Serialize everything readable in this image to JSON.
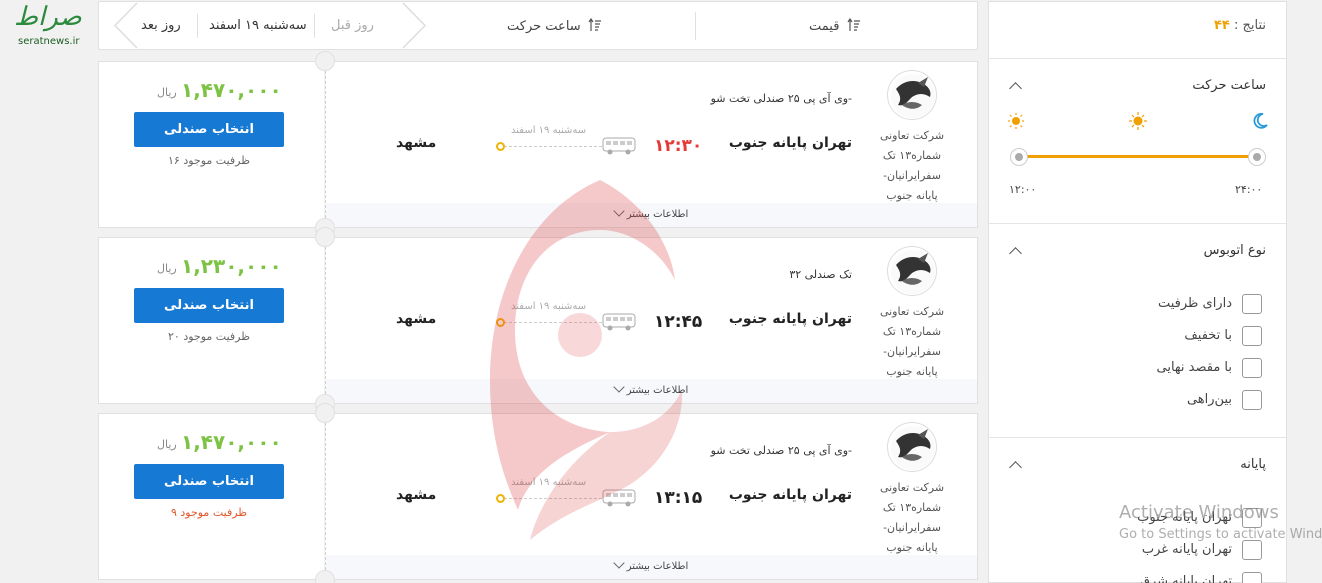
{
  "watermark": {
    "site": "seratnews.ir",
    "mark": "صراط"
  },
  "topbar": {
    "next_day": "روز بعد",
    "current_day": "سه‌شنبه ۱۹ اسفند",
    "prev_day": "روز قبل",
    "sort_time": "ساعت حرکت",
    "sort_price": "قیمت"
  },
  "cards": [
    {
      "price": "۱,۴۷۰,۰۰۰",
      "currency": "ریال",
      "select_label": "انتخاب صندلی",
      "capacity": "ظرفیت موجود ۱۶",
      "capacity_low": false,
      "bus_type": "وی آی پی ۲۵ صندلی تخت شو-",
      "origin": "تهران پایانه جنوب",
      "time": "۱۲:۳۰",
      "time_red": true,
      "route_date": "سه‌شنبه ۱۹ اسفند",
      "destination": "مشهد",
      "company": "شرکت تعاونی شماره۱۳ تک سفرایرانیان- پایانه جنوب",
      "more": "اطلاعات بیشتر"
    },
    {
      "price": "۱,۲۳۰,۰۰۰",
      "currency": "ریال",
      "select_label": "انتخاب صندلی",
      "capacity": "ظرفیت موجود ۲۰",
      "capacity_low": false,
      "bus_type": "تک صندلی ۳۲",
      "origin": "تهران پایانه جنوب",
      "time": "۱۲:۴۵",
      "time_red": false,
      "route_date": "سه‌شنبه ۱۹ اسفند",
      "destination": "مشهد",
      "company": "شرکت تعاونی شماره۱۳ تک سفرایرانیان- پایانه جنوب",
      "more": "اطلاعات بیشتر"
    },
    {
      "price": "۱,۴۷۰,۰۰۰",
      "currency": "ریال",
      "select_label": "انتخاب صندلی",
      "capacity": "ظرفیت موجود ۹",
      "capacity_low": true,
      "bus_type": "وی آی پی ۲۵ صندلی تخت شو-",
      "origin": "تهران پایانه جنوب",
      "time": "۱۳:۱۵",
      "time_red": false,
      "route_date": "سه‌شنبه ۱۹ اسفند",
      "destination": "مشهد",
      "company": "شرکت تعاونی شماره۱۳ تک سفرایرانیان- پایانه جنوب",
      "more": "اطلاعات بیشتر"
    }
  ],
  "sidebar": {
    "results_label": "نتایج :",
    "results_count": "۴۴",
    "departure_title": "ساعت حرکت",
    "slider_min": "۱۲:۰۰",
    "slider_max": "۲۴:۰۰",
    "bus_type_title": "نوع اتوبوس",
    "bus_type_options": [
      "دارای ظرفیت",
      "با تخفیف",
      "با مقصد نهایی",
      "بین‌راهی"
    ],
    "terminal_title": "پایانه",
    "terminal_options": [
      "تهران پایانه جنوب",
      "تهران پایانه غرب",
      "تهران پایانه شرق"
    ]
  },
  "os_notice": {
    "title": "Activate Windows",
    "sub": "Go to Settings to activate Windows."
  },
  "colors": {
    "accent": "#1679d3",
    "price": "#7cc243",
    "warning": "#e2572a",
    "slider": "#f0a000"
  }
}
